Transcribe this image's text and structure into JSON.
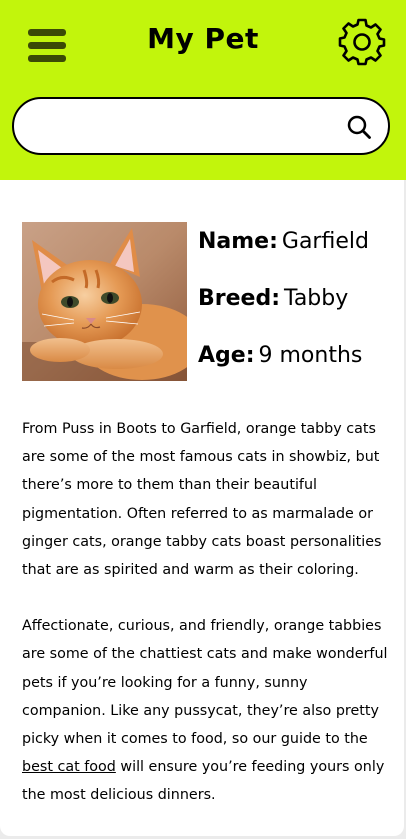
{
  "header": {
    "title": "My Pet",
    "menu_icon": "hamburger-menu-icon",
    "settings_icon": "gear-icon",
    "background_color": "#c2f50c"
  },
  "search": {
    "placeholder": "",
    "value": "",
    "icon": "search-icon"
  },
  "pet": {
    "photo_icon": "orange-kitten-photo",
    "name_label": "Name:",
    "name_value": "Garfield",
    "breed_label": "Breed:",
    "breed_value": "Tabby",
    "age_label": "Age:",
    "age_value": "9 months"
  },
  "description": {
    "paragraph1": "From Puss in Boots to Garfield, orange tabby cats are some of the most famous cats in showbiz, but there’s more to them than their beautiful pigmentation. Often referred to as marmalade or ginger cats, orange tabby cats boast personalities that are as spirited and warm as their coloring.",
    "paragraph2_before": "Affectionate, curious, and friendly, orange tabbies are some of the chattiest cats and make wonderful pets if you’re looking for a funny, sunny companion. Like any pussycat, they’re also pretty picky when it comes to food, so our guide to the ",
    "paragraph2_link": "best cat food",
    "paragraph2_after": " will ensure you’re feeding yours only the most delicious dinners."
  }
}
